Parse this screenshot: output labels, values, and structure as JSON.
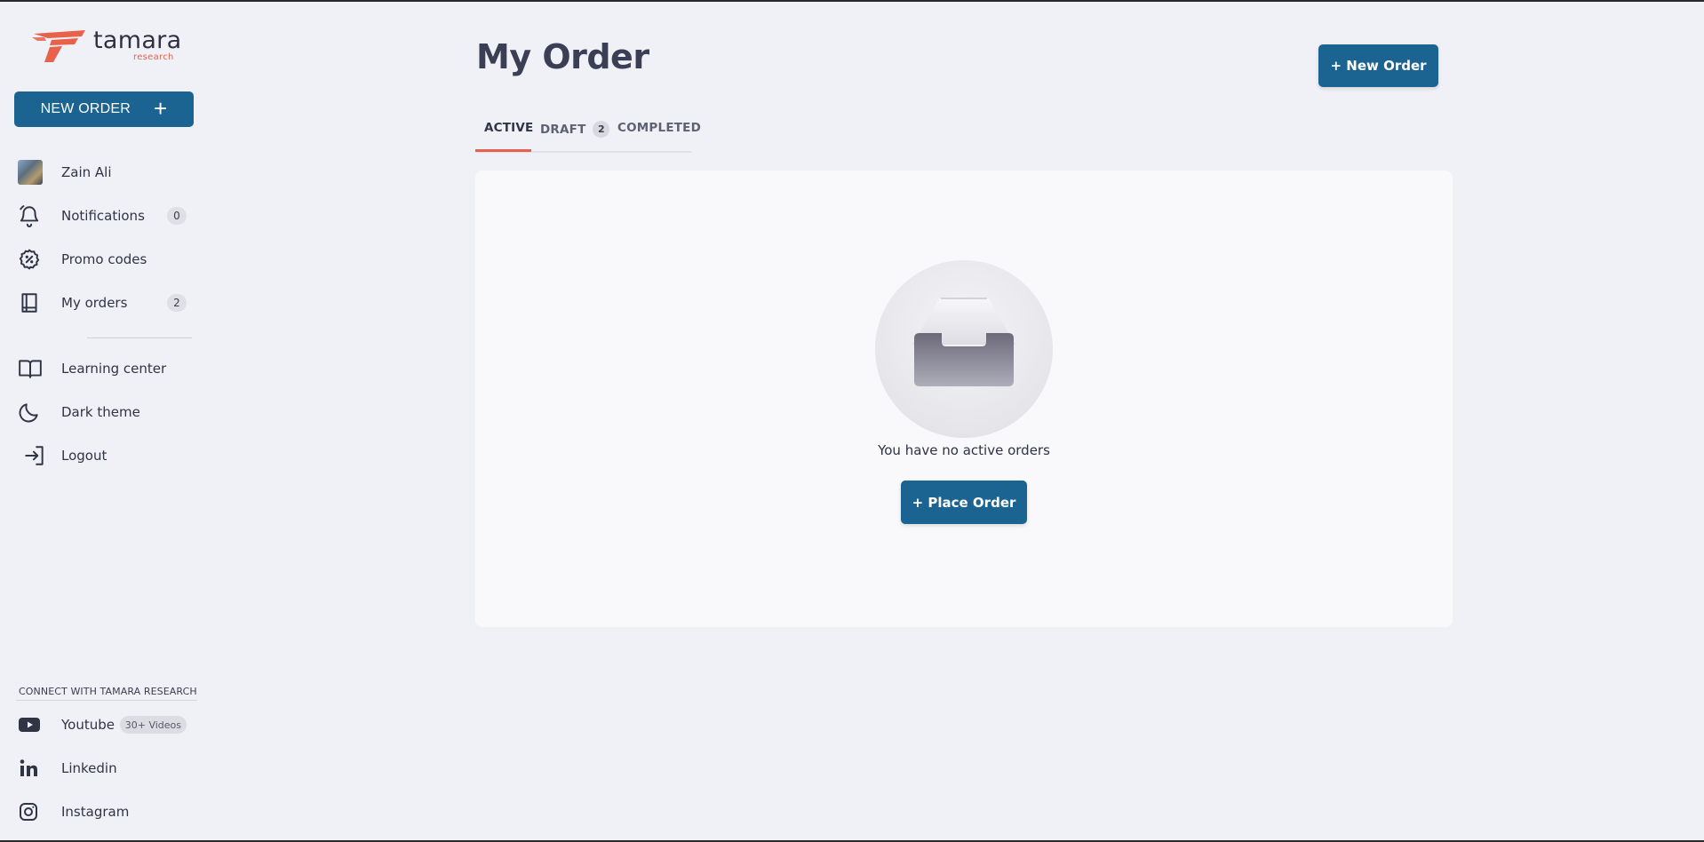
{
  "brand": {
    "name": "tamara",
    "sub": "research",
    "accent": "#e8614a",
    "primary": "#1b6390"
  },
  "sidebar": {
    "new_order_label": "NEW ORDER",
    "new_order_icon": "plus-icon",
    "items": [
      {
        "label": "Zain Ali",
        "icon": "avatar"
      },
      {
        "label": "Notifications",
        "icon": "bell-icon",
        "count": "0"
      },
      {
        "label": "Promo codes",
        "icon": "discount-icon"
      },
      {
        "label": "My orders",
        "icon": "book-icon",
        "count": "2"
      },
      {
        "label": "Learning center",
        "icon": "open-book-icon"
      },
      {
        "label": "Dark theme",
        "icon": "moon-icon"
      },
      {
        "label": "Logout",
        "icon": "logout-icon"
      }
    ],
    "connect_title": "CONNECT WITH TAMARA RESEARCH",
    "social": [
      {
        "label": "Youtube",
        "icon": "youtube-icon",
        "badge": "30+ Videos"
      },
      {
        "label": "Linkedin",
        "icon": "linkedin-icon"
      },
      {
        "label": "Instagram",
        "icon": "instagram-icon"
      }
    ]
  },
  "main": {
    "title": "My Order",
    "new_order_button": "+ New Order",
    "tabs": [
      {
        "label": "ACTIVE",
        "active": true
      },
      {
        "label": "DRAFT",
        "badge": "2"
      },
      {
        "label": "COMPLETED"
      }
    ],
    "empty_icon": "inbox-icon",
    "empty_message": "You have no active orders",
    "place_order_button": "+ Place Order"
  }
}
